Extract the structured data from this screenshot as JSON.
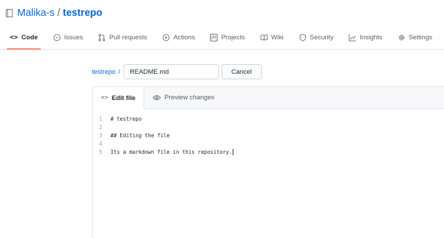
{
  "repo": {
    "owner": "Malika-s",
    "separator": "/",
    "name": "testrepo"
  },
  "nav": {
    "tabs": [
      {
        "label": "Code",
        "icon": "code-icon",
        "active": true
      },
      {
        "label": "Issues",
        "icon": "issue-icon"
      },
      {
        "label": "Pull requests",
        "icon": "pull-request-icon"
      },
      {
        "label": "Actions",
        "icon": "play-icon"
      },
      {
        "label": "Projects",
        "icon": "project-icon"
      },
      {
        "label": "Wiki",
        "icon": "book-icon"
      },
      {
        "label": "Security",
        "icon": "shield-icon"
      },
      {
        "label": "Insights",
        "icon": "graph-icon"
      },
      {
        "label": "Settings",
        "icon": "gear-icon"
      }
    ],
    "code_glyph": "<>"
  },
  "breadcrumb": {
    "repo": "testrepo",
    "slash": "/",
    "filename": "README.md",
    "cancel_label": "Cancel"
  },
  "editor": {
    "tabs": [
      {
        "label": "Edit file",
        "glyph": "<>"
      },
      {
        "label": "Preview changes"
      }
    ],
    "lines": [
      {
        "n": "1",
        "text": "# testrepo"
      },
      {
        "n": "2",
        "text": ""
      },
      {
        "n": "3",
        "text": "## Editing the file"
      },
      {
        "n": "4",
        "text": ""
      },
      {
        "n": "5",
        "text": "Its a markdown file in this repository."
      }
    ]
  },
  "colors": {
    "link": "#0366d6",
    "active_tab_underline": "#f9826c",
    "text": "#24292e",
    "muted": "#586069"
  }
}
